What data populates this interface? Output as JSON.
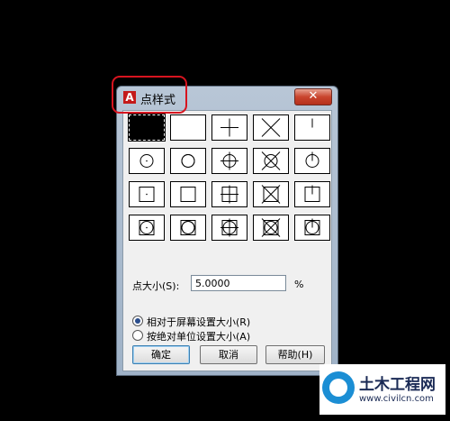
{
  "window": {
    "title": "点样式",
    "app_icon_glyph": "A",
    "close_glyph": "✕"
  },
  "point_styles": [
    [
      "dot",
      "none",
      "plus",
      "x",
      "tick"
    ],
    [
      "dot-circle",
      "circle",
      "plus-circle",
      "x-circle",
      "tick-circle"
    ],
    [
      "dot-square",
      "square",
      "plus-square",
      "x-square",
      "tick-square"
    ],
    [
      "dot-circle-square",
      "circle-square",
      "plus-circle-square",
      "x-circle-square",
      "tick-circle-square"
    ]
  ],
  "selected_style": "dot",
  "point_size": {
    "label": "点大小(S):",
    "value": "5.0000",
    "unit": "%"
  },
  "size_mode": {
    "relative_label": "相对于屏幕设置大小(R)",
    "absolute_label": "按绝对单位设置大小(A)",
    "selected": "relative"
  },
  "buttons": {
    "ok": "确定",
    "cancel": "取消",
    "help": "帮助(H)"
  },
  "watermark": {
    "name": "土木工程网",
    "url": "www.civilcn.com"
  },
  "colors": {
    "highlight": "#d7141f",
    "close_button": "#c9442d"
  }
}
